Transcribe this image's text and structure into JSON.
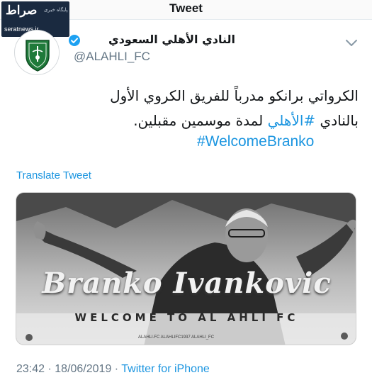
{
  "header": {
    "title": "Tweet"
  },
  "watermark": {
    "logo": "صراط",
    "tag": "پایگاه خبری",
    "site": "seratnews.ir"
  },
  "account": {
    "display_name": "النادي الأهلي السعودي",
    "handle": "@ALAHLI_FC",
    "verified": true,
    "avatar_icon": "club-crest-icon",
    "accent_green": "#1f7a3a"
  },
  "tweet": {
    "line1": "الكرواتي برانكو مدرباً للفريق الكروي الأول",
    "line2_before": "بالنادي ",
    "line2_hashtag": "#الأهلي",
    "line2_after": " لمدة موسمين مقبلين.",
    "hashtag_line": "#WelcomeBranko",
    "hashtag_color": "#1b95e0"
  },
  "translate_label": "Translate Tweet",
  "media": {
    "name_text": "Branko Ivankovic",
    "welcome_text": "WELCOME TO AL AHLI FC",
    "footer_text": "ALAHLI.FC   ALAHLIFC1937   ALAHLI_FC",
    "footer_right": "ALAHLI_FC"
  },
  "meta": {
    "time": "23:42",
    "separator": " · ",
    "date": "18/06/2019",
    "source": "Twitter for iPhone"
  }
}
